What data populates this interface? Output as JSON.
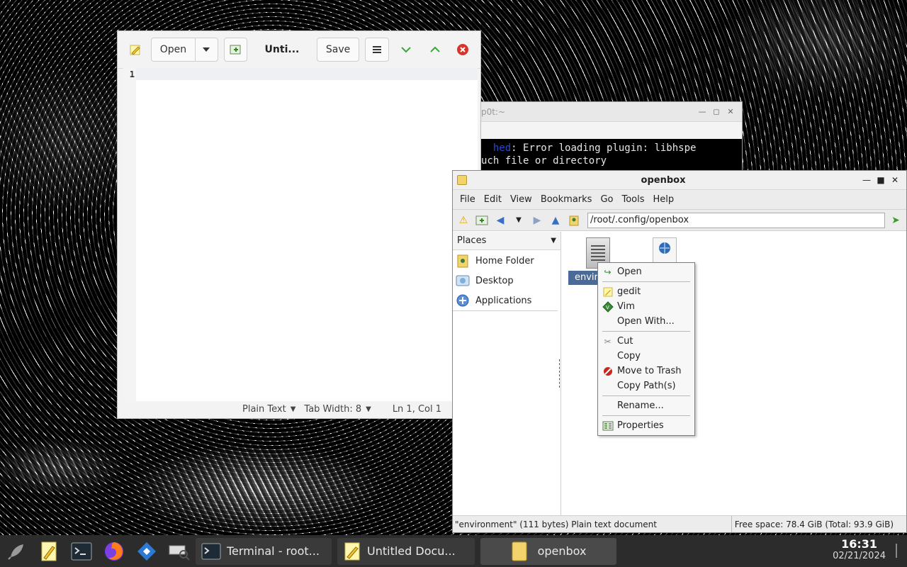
{
  "terminal": {
    "title_fragment": "p0t:~",
    "line1_prefix": "",
    "line1": ": Error loading plugin: libhspe",
    "line2": "uch file or directory"
  },
  "gedit": {
    "open_label": "Open",
    "tab_title": "Unti...",
    "save_label": "Save",
    "line_number": "1",
    "status": {
      "language": "Plain Text",
      "tab_width": "Tab Width: 8",
      "position": "Ln 1, Col 1"
    }
  },
  "filemanager": {
    "title": "openbox",
    "menu": [
      "File",
      "Edit",
      "View",
      "Bookmarks",
      "Go",
      "Tools",
      "Help"
    ],
    "path": "/root/.config/openbox",
    "places_header": "Places",
    "places": [
      "Home Folder",
      "Desktop",
      "Applications"
    ],
    "selected_file_label": "enviro",
    "status_left": "\"environment\" (111 bytes) Plain text document",
    "status_right": "Free space: 78.4 GiB (Total: 93.9 GiB)"
  },
  "context_menu": {
    "items": [
      {
        "label": "Open",
        "icon": "open-icon"
      },
      {
        "label": "gedit",
        "icon": "gedit-icon"
      },
      {
        "label": "Vim",
        "icon": "vim-icon"
      },
      {
        "label": "Open With...",
        "icon": ""
      },
      {
        "label": "Cut",
        "icon": "scissors-icon"
      },
      {
        "label": "Copy",
        "icon": ""
      },
      {
        "label": "Move to Trash",
        "icon": "no-entry-icon"
      },
      {
        "label": "Copy Path(s)",
        "icon": ""
      },
      {
        "label": "Rename...",
        "icon": ""
      },
      {
        "label": "Properties",
        "icon": "properties-icon"
      }
    ]
  },
  "taskbar": {
    "tasks": [
      {
        "label": "Terminal - root...",
        "icon": "terminal-icon"
      },
      {
        "label": "Untitled Docu...",
        "icon": "text-editor-icon"
      },
      {
        "label": "openbox",
        "icon": "folder-icon"
      }
    ],
    "time": "16:31",
    "date": "02/21/2024"
  }
}
